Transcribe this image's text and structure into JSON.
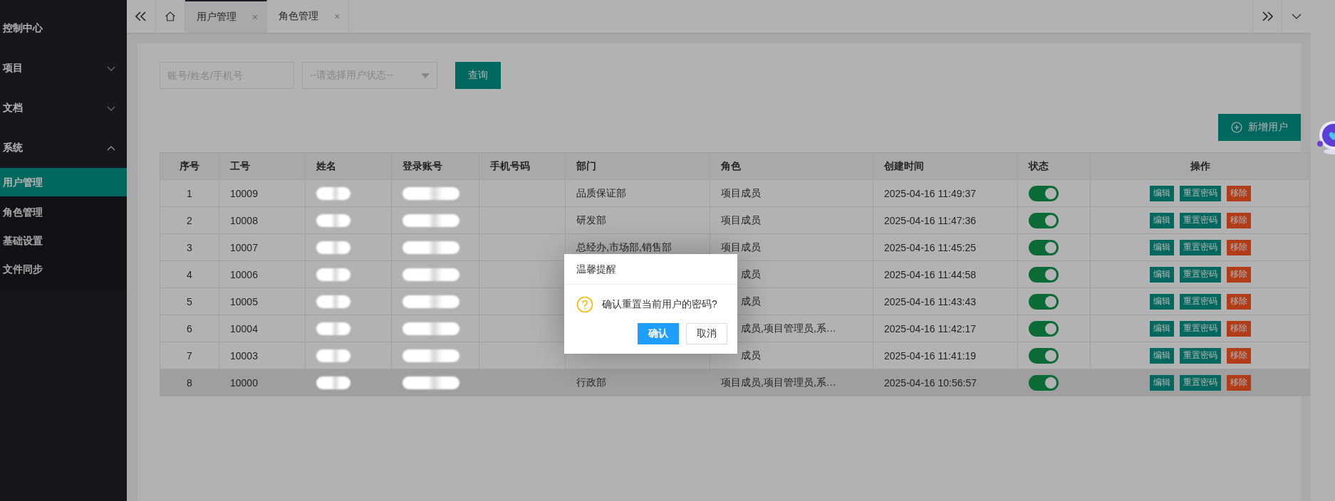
{
  "sidebar": {
    "items": [
      {
        "label": "控制中心",
        "selected": false
      },
      {
        "label": "项目",
        "expanded": false,
        "selected": false
      },
      {
        "label": "文档",
        "expanded": false,
        "selected": false
      },
      {
        "label": "系统",
        "expanded": true,
        "selected": false,
        "children": [
          {
            "label": "用户管理",
            "selected": true
          },
          {
            "label": "角色管理",
            "selected": false
          },
          {
            "label": "基础设置",
            "selected": false
          },
          {
            "label": "文件同步",
            "selected": false
          }
        ]
      }
    ]
  },
  "tabs": [
    {
      "label": "用户管理",
      "close": "×",
      "selected": true
    },
    {
      "label": "角色管理",
      "close": "×",
      "selected": false
    }
  ],
  "search": {
    "placeholder": "账号/姓名/手机号",
    "status_placeholder": "--请选择用户状态--",
    "query_button": "查询"
  },
  "add_button": "新增用户",
  "table": {
    "columns": [
      "序号",
      "工号",
      "姓名",
      "登录账号",
      "手机号码",
      "部门",
      "角色",
      "创建时间",
      "状态",
      "操作"
    ],
    "rows": [
      {
        "no": "1",
        "id": "10009",
        "blurred": true,
        "dept": "品质保证部",
        "role": "项目成员",
        "role_cut": false,
        "created": "2025-04-16 11:49:37",
        "on": true,
        "highlighted": false,
        "actions": [
          {
            "label": "编辑",
            "kind": "edit"
          },
          {
            "label": "重置密码",
            "kind": "reset"
          },
          {
            "label": "移除",
            "kind": "remove"
          }
        ]
      },
      {
        "no": "2",
        "id": "10008",
        "blurred": true,
        "dept": "研发部",
        "role": "项目成员",
        "role_cut": false,
        "created": "2025-04-16 11:47:36",
        "on": true,
        "highlighted": false,
        "actions": [
          {
            "label": "编辑",
            "kind": "edit"
          },
          {
            "label": "重置密码",
            "kind": "reset"
          },
          {
            "label": "移除",
            "kind": "remove"
          }
        ]
      },
      {
        "no": "3",
        "id": "10007",
        "blurred": true,
        "dept": "总经办,市场部,销售部",
        "role": "项目成员",
        "role_cut": false,
        "created": "2025-04-16 11:45:25",
        "on": true,
        "highlighted": false,
        "actions": [
          {
            "label": "编辑",
            "kind": "edit"
          },
          {
            "label": "重置密码",
            "kind": "reset"
          },
          {
            "label": "移除",
            "kind": "remove"
          }
        ]
      },
      {
        "no": "4",
        "id": "10006",
        "blurred": true,
        "role": "成员",
        "role_cut": true,
        "created": "2025-04-16 11:44:58",
        "on": true,
        "highlighted": false,
        "actions": [
          {
            "label": "编辑",
            "kind": "edit"
          },
          {
            "label": "重置密码",
            "kind": "reset"
          },
          {
            "label": "移除",
            "kind": "remove"
          }
        ]
      },
      {
        "no": "5",
        "id": "10005",
        "blurred": true,
        "role": "成员",
        "role_cut": true,
        "created": "2025-04-16 11:43:43",
        "on": true,
        "highlighted": false,
        "actions": [
          {
            "label": "编辑",
            "kind": "edit"
          },
          {
            "label": "重置密码",
            "kind": "reset"
          },
          {
            "label": "移除",
            "kind": "remove"
          }
        ]
      },
      {
        "no": "6",
        "id": "10004",
        "blurred": true,
        "role": "成员,项目管理员,系…",
        "role_cut": true,
        "created": "2025-04-16 11:42:17",
        "on": true,
        "highlighted": false,
        "actions": [
          {
            "label": "编辑",
            "kind": "edit"
          },
          {
            "label": "重置密码",
            "kind": "reset"
          },
          {
            "label": "移除",
            "kind": "remove"
          }
        ]
      },
      {
        "no": "7",
        "id": "10003",
        "blurred": true,
        "role": "成员",
        "role_cut": true,
        "created": "2025-04-16 11:41:19",
        "on": true,
        "highlighted": false,
        "actions": [
          {
            "label": "编辑",
            "kind": "edit"
          },
          {
            "label": "重置密码",
            "kind": "reset"
          },
          {
            "label": "移除",
            "kind": "remove"
          }
        ]
      },
      {
        "no": "8",
        "id": "10000",
        "blurred": true,
        "dept": "行政部",
        "role": "项目成员,项目管理员,系…",
        "role_cut": false,
        "created": "2025-04-16 10:56:57",
        "on": true,
        "highlighted": true,
        "actions": [
          {
            "label": "编辑",
            "kind": "edit"
          },
          {
            "label": "重置密码",
            "kind": "reset"
          },
          {
            "label": "移除",
            "kind": "remove"
          }
        ]
      }
    ]
  },
  "dialog": {
    "title": "温馨提醒",
    "message": "确认重置当前用户的密码?",
    "buttons": [
      {
        "label": "确认",
        "kind": "primary"
      },
      {
        "label": "取消",
        "kind": "default"
      }
    ]
  }
}
